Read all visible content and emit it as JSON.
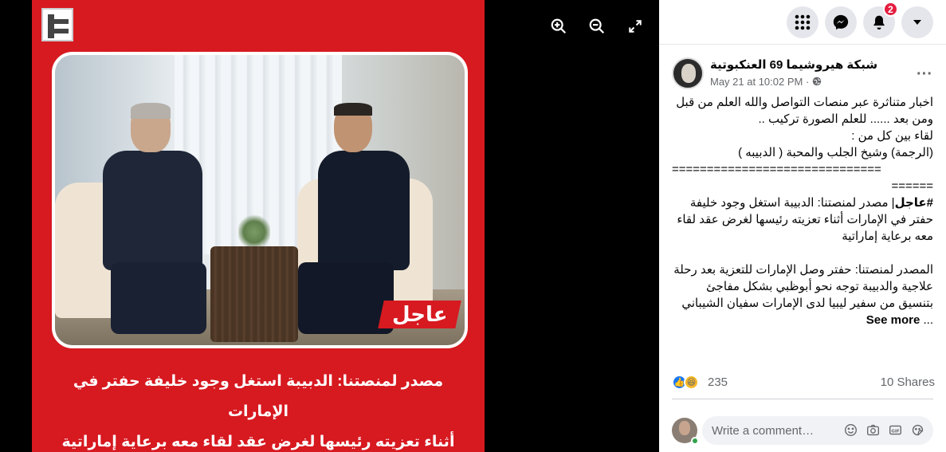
{
  "photo": {
    "badge": "عاجل",
    "caption_line1": "مصدر لمنصتنا: الدبيبة استغل وجود خليفة حفتر في الإمارات",
    "caption_line2": "أثناء تعزيته رئيسها لغرض عقد لقاء معه برعاية إماراتية"
  },
  "viewer_controls": {
    "zoom_in": "zoom-in-icon",
    "zoom_out": "zoom-out-icon",
    "fullscreen": "fullscreen-icon"
  },
  "topbar": {
    "notification_count": "2"
  },
  "post": {
    "author": "شبكة هيروشيما 69 العنكبوتية",
    "date": "May 21 at 10:02 PM",
    "separator": " · ",
    "text_lines": [
      "اخبار متناثرة عبر منصات التواصل والله العلم من قبل",
      "ومن بعد ...... للعلم الصورة تركيب ..",
      "لقاء بين كل من :",
      "(الرجمة) وشيخ الجلب والمحبة ( الدبيبه )",
      "==============================",
      "======"
    ],
    "hashtag": "#عاجل",
    "hashtag_text": "| مصدر لمنصتنا: الدبيبة استغل وجود خليفة حفتر في الإمارات أثناء تعزيته رئيسها لغرض عقد لقاء معه برعاية إماراتية",
    "paragraph2": "المصدر لمنصتنا: حفتر وصل الإمارات للتعزية بعد رحلة علاجية والدبيبة توجه نحو أبوظبي بشكل مفاجئ بتنسيق من سفير ليبيا لدى الإمارات سفيان الشيباني ...",
    "see_more": "See more"
  },
  "reactions": {
    "count": "235",
    "shares": "10 Shares"
  },
  "comment": {
    "placeholder": "Write a comment…"
  },
  "colors": {
    "brand_red": "#d71920",
    "facebook_blue": "#1877f2",
    "notification_red": "#e41e3f"
  }
}
